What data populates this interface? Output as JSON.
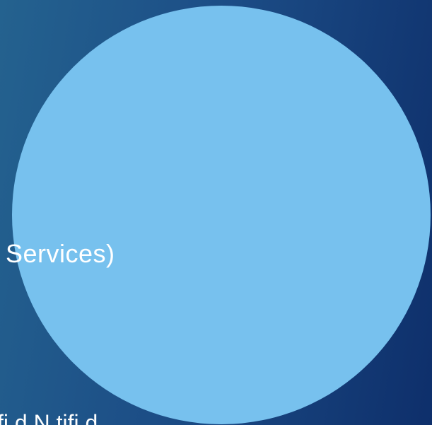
{
  "slide": {
    "partial_text": "Services)",
    "bottom_partial_text": "fi d N tifi d"
  },
  "colors": {
    "background_left": "#24628f",
    "background_right": "#0e2f6b",
    "circle": "#77c1ee",
    "text": "#ffffff"
  }
}
